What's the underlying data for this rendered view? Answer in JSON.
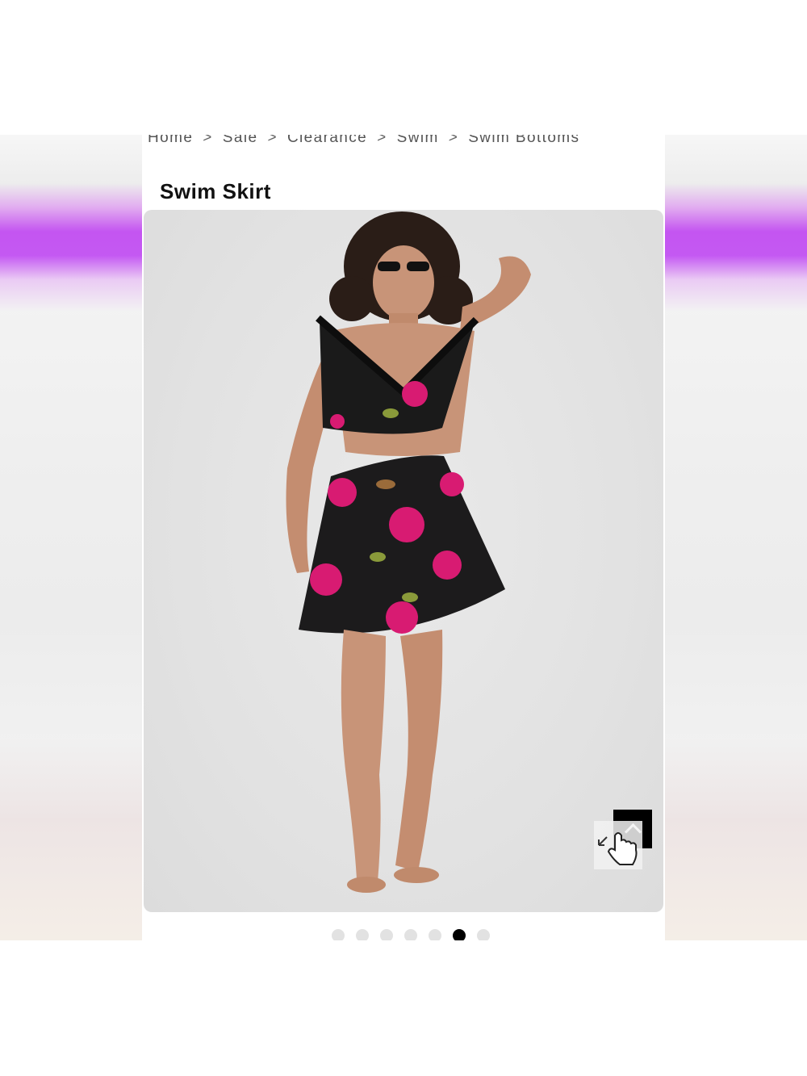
{
  "breadcrumb": {
    "items": [
      "Home",
      "Sale",
      "Clearance",
      "Swim",
      "Swim Bottoms"
    ],
    "separator": ">"
  },
  "product": {
    "title": "Swim Skirt"
  },
  "gallery": {
    "image_alt": "Model wearing black floral ruffle bikini top with floral swim skirt",
    "expand_icon": "expand-icon",
    "cursor_icon": "hand-pointer-icon",
    "dot_count": 7,
    "active_dot": 6
  },
  "colors": {
    "accent_purple": "#c14cf0",
    "active_dot": "#000000",
    "inactive_dot": "#e2e2e2",
    "swimsuit_pink": "#d81b72"
  }
}
